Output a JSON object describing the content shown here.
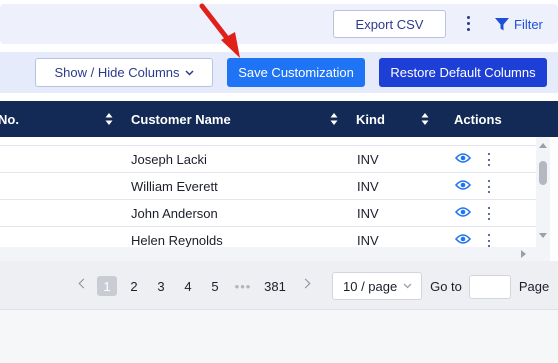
{
  "toolbar": {
    "export_label": "Export CSV",
    "filter_label": "Filter"
  },
  "actions_bar": {
    "show_hide_label": "Show / Hide Columns",
    "save_label": "Save Customization",
    "restore_label": "Restore Default Columns"
  },
  "table": {
    "columns": [
      "No.",
      "Customer Name",
      "Kind",
      "Actions"
    ],
    "rows": [
      {
        "customer": "",
        "kind": ""
      },
      {
        "customer": "Joseph Lacki",
        "kind": "INV"
      },
      {
        "customer": "William Everett",
        "kind": "INV"
      },
      {
        "customer": "John Anderson",
        "kind": "INV"
      },
      {
        "customer": "Helen Reynolds",
        "kind": "INV"
      }
    ]
  },
  "pagination": {
    "pages": [
      "1",
      "2",
      "3",
      "4",
      "5",
      "•••",
      "381"
    ],
    "current_page": "1",
    "page_size": "10 / page",
    "goto_label": "Go to",
    "page_label": "Page"
  },
  "colors": {
    "header_bg": "#122a55",
    "save_button": "#1f74f5",
    "restore_button": "#1d3fd6",
    "annotation_arrow": "#e0201b"
  },
  "icons": [
    "more-vertical-icon",
    "filter-icon",
    "chevron-down-icon",
    "sort-icon",
    "eye-icon",
    "red-arrow-annotation"
  ]
}
